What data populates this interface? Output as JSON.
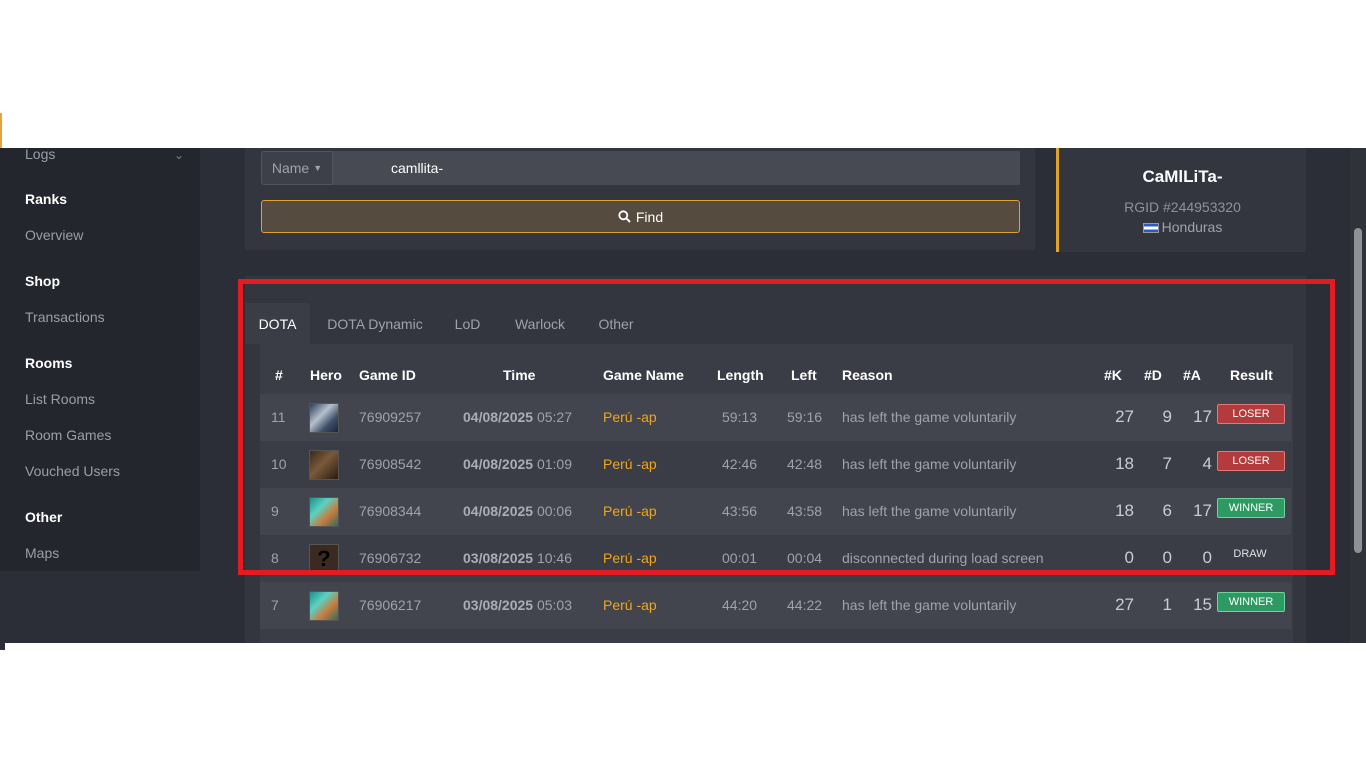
{
  "sidebar": {
    "logs_label": "Logs",
    "sections": [
      {
        "title": "Ranks",
        "items": [
          "Overview"
        ]
      },
      {
        "title": "Shop",
        "items": [
          "Transactions"
        ]
      },
      {
        "title": "Rooms",
        "items": [
          "List Rooms",
          "Room Games",
          "Vouched Users"
        ]
      },
      {
        "title": "Other",
        "items": [
          "Maps"
        ]
      }
    ]
  },
  "search": {
    "filter_label": "Name",
    "value": "camllita-",
    "find_label": "Find"
  },
  "profile": {
    "name": "CaMlLiTa-",
    "rgid": "RGID #244953320",
    "country": "Honduras"
  },
  "tabs": [
    "DOTA",
    "DOTA Dynamic",
    "LoD",
    "Warlock",
    "Other"
  ],
  "table": {
    "columns": [
      "#",
      "Hero",
      "Game ID",
      "Time",
      "Game Name",
      "Length",
      "Left",
      "Reason",
      "#K",
      "#D",
      "#A",
      "Result"
    ],
    "rows": [
      {
        "num": "11",
        "hero_icon": "hero-portrait-panda",
        "game_id": "76909257",
        "date": "04/08/2025",
        "time": "05:27",
        "game_name": "Perú -ap",
        "length": "59:13",
        "left": "59:16",
        "reason": "has left the game voluntarily",
        "k": "27",
        "d": "9",
        "a": "17",
        "result": "LOSER"
      },
      {
        "num": "10",
        "hero_icon": "hero-portrait-dark",
        "game_id": "76908542",
        "date": "04/08/2025",
        "time": "01:09",
        "game_name": "Perú -ap",
        "length": "42:46",
        "left": "42:48",
        "reason": "has left the game voluntarily",
        "k": "18",
        "d": "7",
        "a": "4",
        "result": "LOSER"
      },
      {
        "num": "9",
        "hero_icon": "hero-portrait-teal",
        "game_id": "76908344",
        "date": "04/08/2025",
        "time": "00:06",
        "game_name": "Perú -ap",
        "length": "43:56",
        "left": "43:58",
        "reason": "has left the game voluntarily",
        "k": "18",
        "d": "6",
        "a": "17",
        "result": "WINNER"
      },
      {
        "num": "8",
        "hero_icon": "hero-portrait-unknown",
        "game_id": "76906732",
        "date": "03/08/2025",
        "time": "10:46",
        "game_name": "Perú -ap",
        "length": "00:01",
        "left": "00:04",
        "reason": "disconnected during load screen",
        "k": "0",
        "d": "0",
        "a": "0",
        "result": "DRAW"
      },
      {
        "num": "7",
        "hero_icon": "hero-portrait-teal",
        "game_id": "76906217",
        "date": "03/08/2025",
        "time": "05:03",
        "game_name": "Perú -ap",
        "length": "44:20",
        "left": "44:22",
        "reason": "has left the game voluntarily",
        "k": "27",
        "d": "1",
        "a": "15",
        "result": "WINNER"
      }
    ]
  },
  "colors": {
    "accent": "#e0a32e",
    "game_name": "#f0a51d",
    "loser": "#b33b3b",
    "winner": "#2d9a63",
    "highlight": "#e31b23"
  }
}
